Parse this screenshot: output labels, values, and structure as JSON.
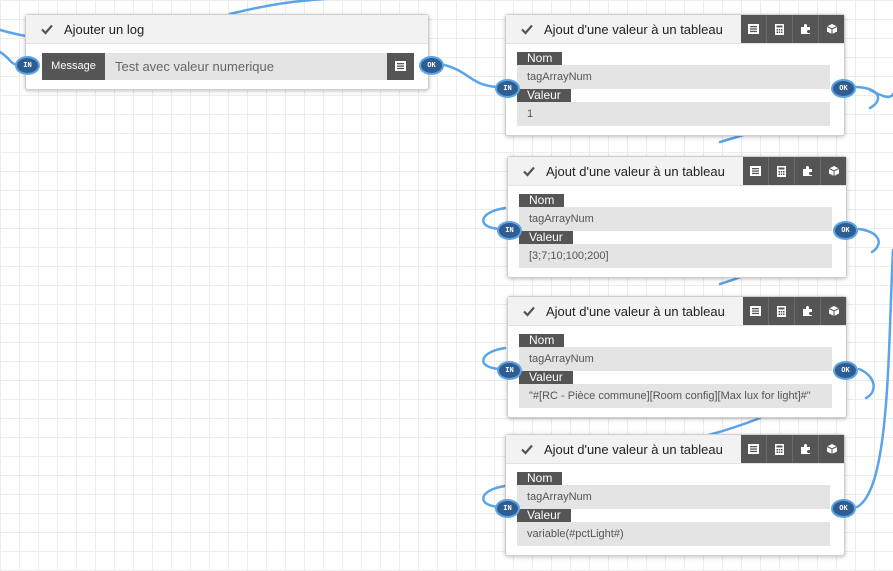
{
  "log_node": {
    "title": "Ajouter un log",
    "message_label": "Message",
    "message_value": "Test avec valeur numerique",
    "in_port": "IN",
    "ok_port": "OK"
  },
  "array_nodes": [
    {
      "title": "Ajout d'une valeur à un tableau",
      "name_label": "Nom",
      "name_value": "tagArrayNum",
      "value_label": "Valeur",
      "value_value": "1",
      "in_port": "IN",
      "ok_port": "OK"
    },
    {
      "title": "Ajout d'une valeur à un tableau",
      "name_label": "Nom",
      "name_value": "tagArrayNum",
      "value_label": "Valeur",
      "value_value": "[3;7;10;100;200]",
      "in_port": "IN",
      "ok_port": "OK"
    },
    {
      "title": "Ajout d'une valeur à un tableau",
      "name_label": "Nom",
      "name_value": "tagArrayNum",
      "value_label": "Valeur",
      "value_value": "\"#[RC - Pièce commune][Room config][Max lux for light]#\"",
      "in_port": "IN",
      "ok_port": "OK"
    },
    {
      "title": "Ajout d'une valeur à un tableau",
      "name_label": "Nom",
      "name_value": "tagArrayNum",
      "value_label": "Valeur",
      "value_value": "variable(#pctLight#)",
      "in_port": "IN",
      "ok_port": "OK"
    }
  ],
  "icons": {
    "check": "check-icon",
    "list": "list-icon",
    "calculator": "calculator-icon",
    "plugin": "puzzle-icon",
    "box": "cube-icon"
  },
  "colors": {
    "wire": "#5ba4e8",
    "port_fill": "#2f5d90",
    "dark_label": "#555555",
    "input_bg": "#e4e4e4"
  }
}
